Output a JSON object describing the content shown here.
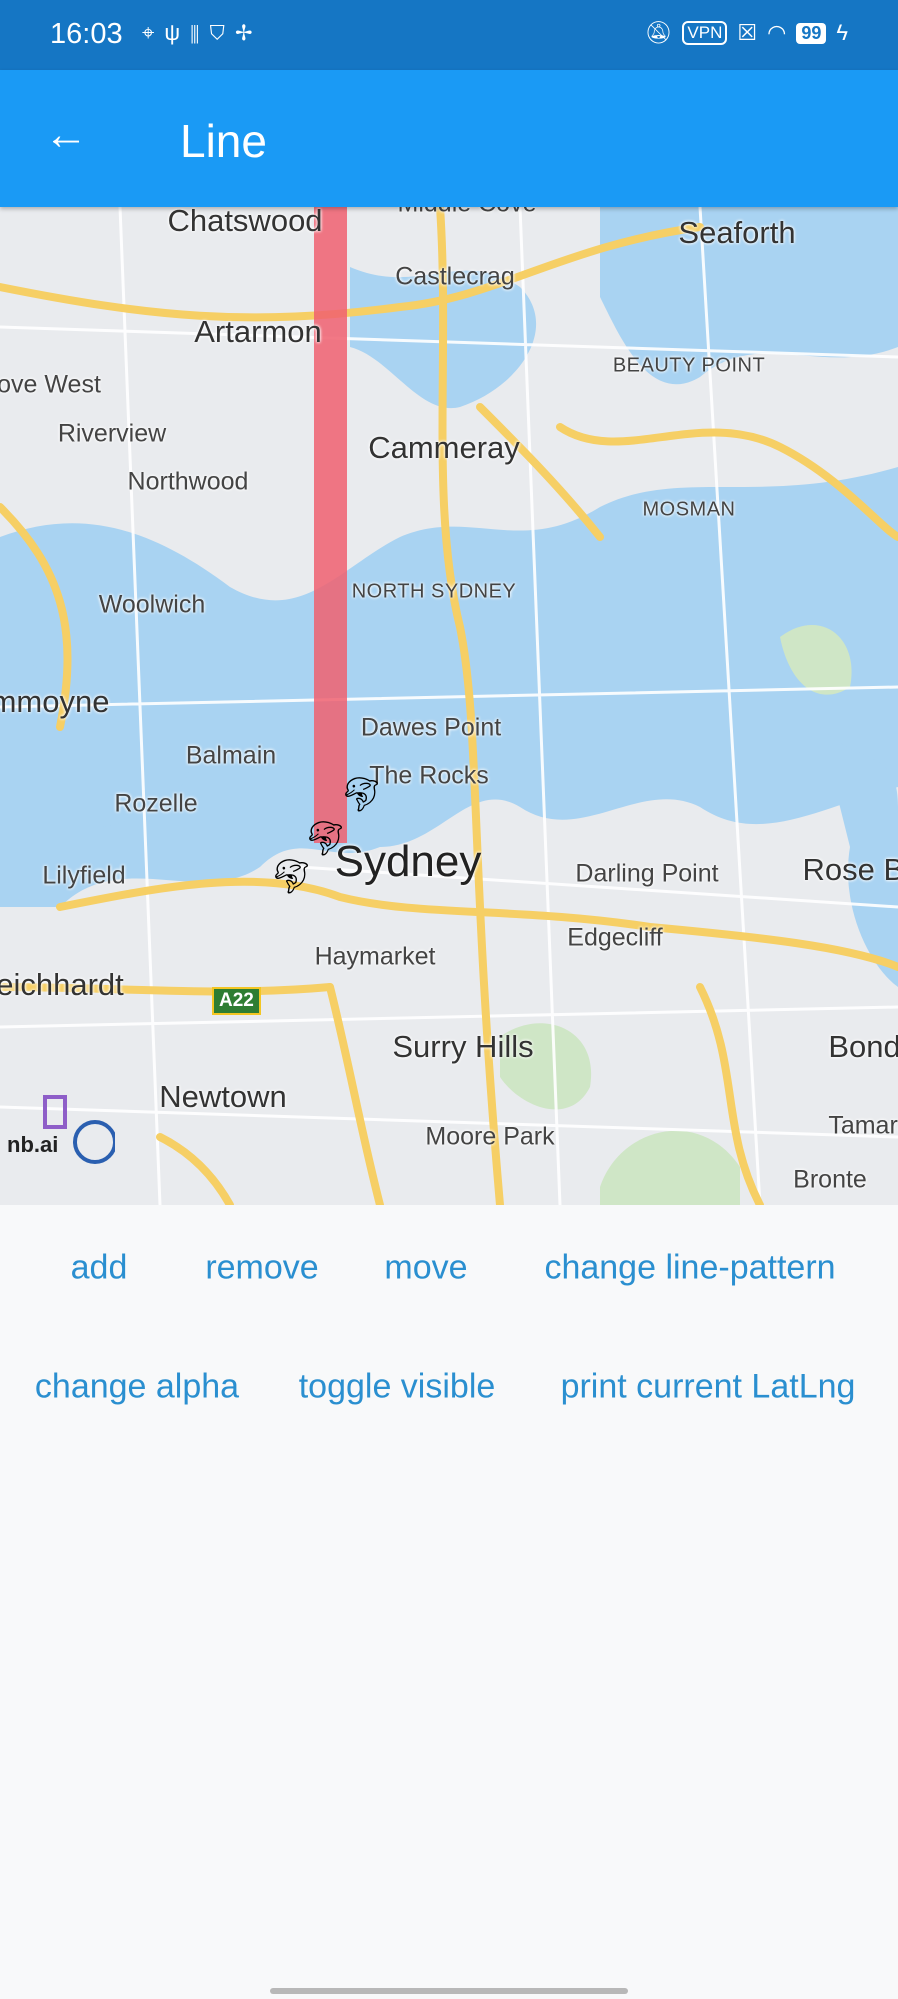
{
  "status_bar": {
    "time": "16:03",
    "left_icons": [
      "location-icon",
      "usb-icon",
      "signal-bars-icon",
      "shield-check-icon",
      "fan-icon"
    ],
    "right_icons": [
      "bell-off-icon",
      "vpn-icon",
      "sim-x-icon",
      "wifi-icon",
      "battery-icon",
      "charging-icon"
    ],
    "vpn": "VPN",
    "battery": "99"
  },
  "app_bar": {
    "back_icon": "arrow-left-icon",
    "title": "Line"
  },
  "map": {
    "line_color": "#f06070",
    "labels": [
      "Chatswood",
      "Middle Cove",
      "Seaforth",
      "Castlecrag",
      "Artarmon",
      "Cove West",
      "BEAUTY POINT",
      "Riverview",
      "Cammeray",
      "Northwood",
      "MOSMAN",
      "Woolwich",
      "NORTH SYDNEY",
      "mmoyne",
      "Dawes Point",
      "Balmain",
      "The Rocks",
      "Rozelle",
      "Sydney",
      "Darling Point",
      "Rose Ba",
      "Lilyfield",
      "Edgecliff",
      "Haymarket",
      "eichhardt",
      "Surry Hills",
      "Bondi",
      "Newtown",
      "Moore Park",
      "Tamara",
      "Bronte"
    ],
    "road_shield": "A22",
    "logo": "nb.ai",
    "markers": [
      "dolphin-marker",
      "dolphin-marker",
      "dolphin-marker"
    ]
  },
  "buttons": {
    "add": "add",
    "remove": "remove",
    "move": "move",
    "change_line_pattern": "change line-pattern",
    "change_alpha": "change alpha",
    "toggle_visible": "toggle visible",
    "print_latlng": "print current LatLng"
  },
  "colors": {
    "status_bar": "#1576c4",
    "app_bar": "#1a9af5",
    "button_text": "#2a8fd0",
    "water": "#a9d3f2",
    "road": "#f6cf65"
  }
}
